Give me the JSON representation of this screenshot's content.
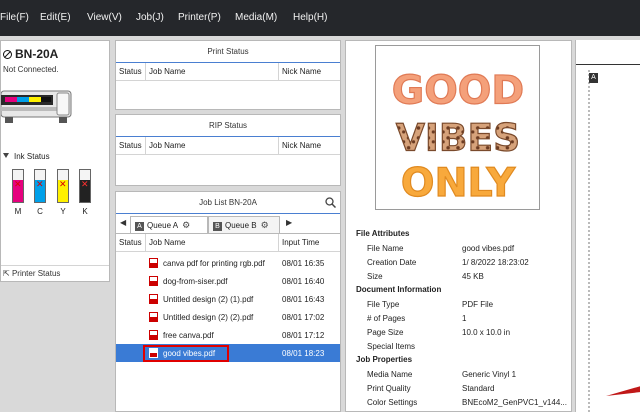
{
  "menu": [
    "File(F)",
    "Edit(E)",
    "View(V)",
    "Job(J)",
    "Printer(P)",
    "Media(M)",
    "Help(H)"
  ],
  "printer": {
    "name": "BN-20A",
    "connection": "Not Connected.",
    "ink_status_label": "Ink Status",
    "inks": [
      {
        "label": "M",
        "color": "#e6007e"
      },
      {
        "label": "C",
        "color": "#00a0e9"
      },
      {
        "label": "Y",
        "color": "#fff100"
      },
      {
        "label": "K",
        "color": "#222222"
      }
    ],
    "status_link": "Printer Status"
  },
  "print_status": {
    "title": "Print Status",
    "columns": [
      "Status",
      "Job Name",
      "Nick Name"
    ]
  },
  "rip_status": {
    "title": "RIP Status",
    "columns": [
      "Status",
      "Job Name",
      "Nick Name"
    ]
  },
  "job_list": {
    "title": "Job List BN-20A",
    "tabs": [
      {
        "badge": "A",
        "label": "Queue A"
      },
      {
        "badge": "B",
        "label": "Queue B"
      }
    ],
    "columns": [
      "Status",
      "Job Name",
      "Input Time"
    ],
    "rows": [
      {
        "name": "canva pdf for printing rgb.pdf",
        "time": "08/01 16:35"
      },
      {
        "name": "dog-from-siser.pdf",
        "time": "08/01 16:40"
      },
      {
        "name": "Untitled design (2) (1).pdf",
        "time": "08/01 16:43"
      },
      {
        "name": "Untitled design (2) (2).pdf",
        "time": "08/01 17:02"
      },
      {
        "name": "free canva.pdf",
        "time": "08/01 17:12"
      },
      {
        "name": "good vibes.pdf",
        "time": "08/01 18:23"
      }
    ],
    "selected_index": 5
  },
  "preview": {
    "line1": "GOOD",
    "line2": "VIBES",
    "line3": "ONLY"
  },
  "file_attributes": {
    "heading": "File Attributes",
    "items": [
      {
        "k": "File Name",
        "v": "good vibes.pdf"
      },
      {
        "k": "Creation Date",
        "v": "1/ 8/2022 18:23:02"
      },
      {
        "k": "Size",
        "v": "45 KB"
      }
    ]
  },
  "document_information": {
    "heading": "Document Information",
    "items": [
      {
        "k": "File Type",
        "v": "PDF File"
      },
      {
        "k": "# of Pages",
        "v": "1"
      },
      {
        "k": "Page Size",
        "v": "10.0 x 10.0 in"
      },
      {
        "k": "Special Items",
        "v": ""
      }
    ]
  },
  "job_properties": {
    "heading": "Job Properties",
    "items": [
      {
        "k": "Media Name",
        "v": "Generic Vinyl 1"
      },
      {
        "k": "Print Quality",
        "v": "Standard"
      },
      {
        "k": "Color Settings",
        "v": "BNEcoM2_GenPVC1_v144..."
      }
    ]
  },
  "canvas": {
    "badge": "A"
  },
  "colors": {
    "selection": "#3a7bd5",
    "highlight_box": "#e00000",
    "accent_line": "#4a7fd1"
  }
}
